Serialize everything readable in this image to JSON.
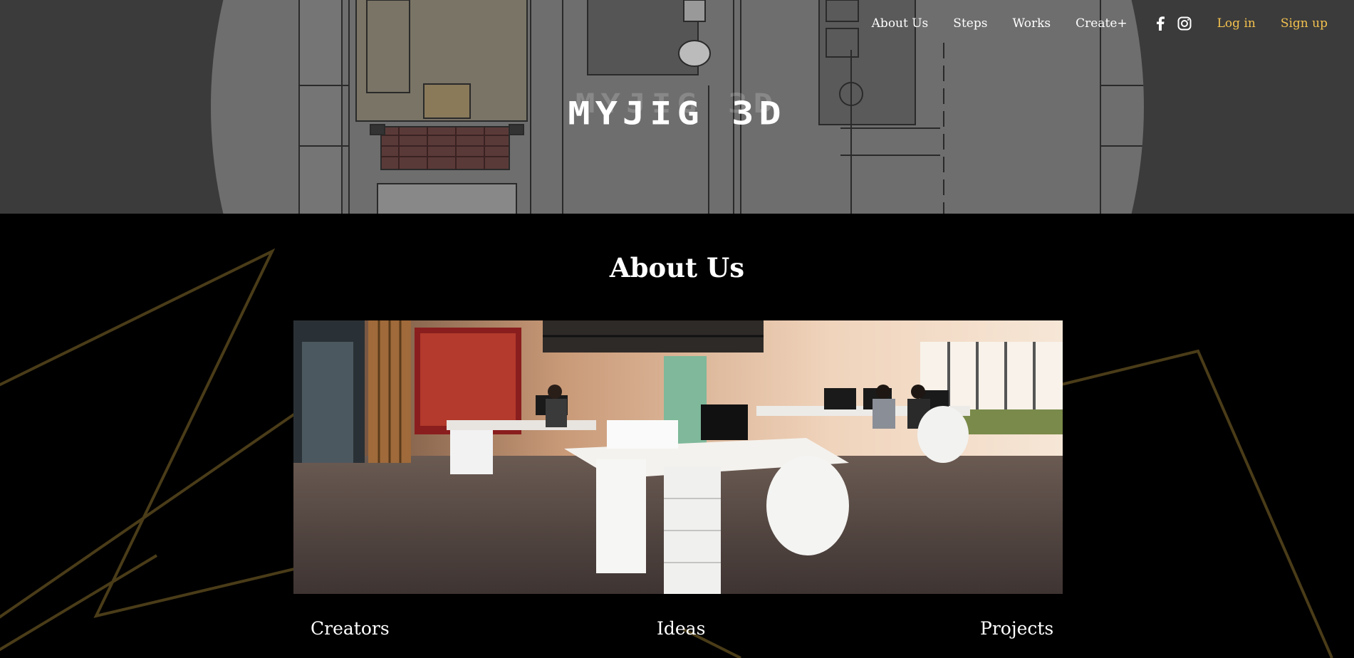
{
  "hero": {
    "logo_text": "MYJIG 3D",
    "background_color": "#3b3b3b"
  },
  "nav": {
    "links": [
      "About Us",
      "Steps",
      "Works",
      "Create+"
    ],
    "social_icons": [
      "facebook-icon",
      "instagram-icon"
    ],
    "login": "Log in",
    "signup": "Sign up",
    "accent_color": "#f2c14e"
  },
  "about": {
    "title": "About Us",
    "image_description": "open-plan office photo",
    "features": [
      "Creators",
      "Ideas",
      "Projects"
    ],
    "line_color": "#4a3c18"
  }
}
